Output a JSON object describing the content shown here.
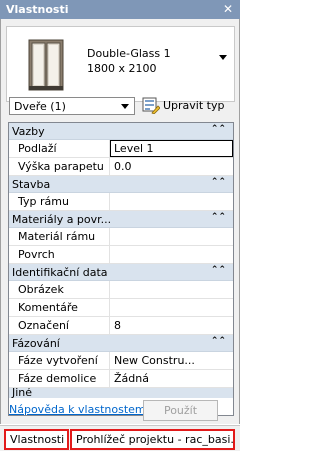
{
  "window": {
    "title": "Vlastnosti",
    "close_glyph": "✕"
  },
  "type_selector": {
    "name": "Double-Glass 1",
    "size": "1800 x 2100",
    "icon": "window-thumbnail-icon"
  },
  "category_filter": {
    "selected": "Dveře (1)"
  },
  "edit_type": {
    "label": "Upravit typ",
    "icon": "edit-type-icon"
  },
  "groups": [
    {
      "title": "Vazby",
      "rows": [
        {
          "label": "Podlaží",
          "value": "Level 1"
        },
        {
          "label": "Výška parapetu",
          "value": "0.0"
        }
      ]
    },
    {
      "title": "Stavba",
      "rows": [
        {
          "label": "Typ rámu",
          "value": ""
        }
      ]
    },
    {
      "title": "Materiály a povr...",
      "rows": [
        {
          "label": "Materiál rámu",
          "value": ""
        },
        {
          "label": "Povrch",
          "value": ""
        }
      ]
    },
    {
      "title": "Identifikační data",
      "rows": [
        {
          "label": "Obrázek",
          "value": ""
        },
        {
          "label": "Komentáře",
          "value": ""
        },
        {
          "label": "Označení",
          "value": "8"
        }
      ]
    },
    {
      "title": "Fázování",
      "rows": [
        {
          "label": "Fáze vytvoření",
          "value": "New Constru..."
        },
        {
          "label": "Fáze demolice",
          "value": "Žádná"
        }
      ]
    }
  ],
  "collapse_glyph": "⌃⌃",
  "cut_group_title": "Jiné",
  "footer": {
    "help_link": "Nápověda k vlastnostem",
    "apply": "Použít"
  },
  "tabs": [
    {
      "label": "Vlastnosti"
    },
    {
      "label": "Prohlížeč projektu - rac_basi..."
    }
  ]
}
